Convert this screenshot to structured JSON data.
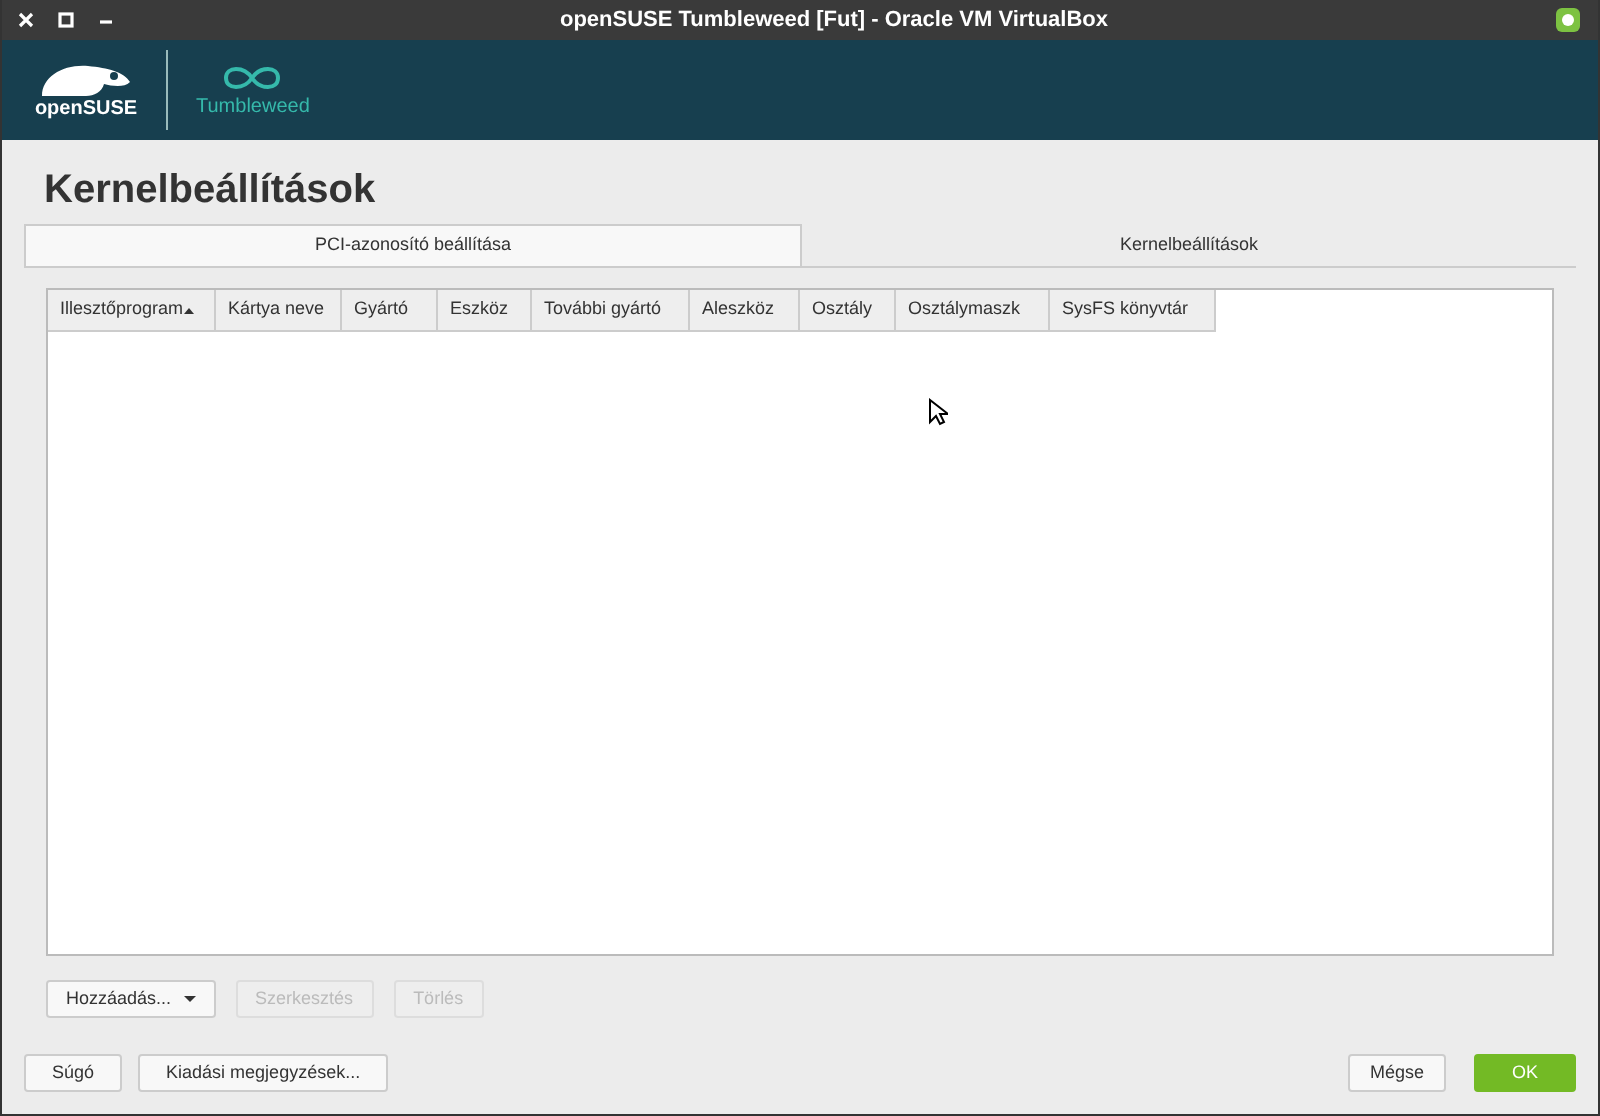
{
  "window": {
    "title": "openSUSE Tumbleweed [Fut] - Oracle VM VirtualBox"
  },
  "banner": {
    "brand": "openSUSE",
    "edition": "Tumbleweed"
  },
  "heading": "Kernelbeállítások",
  "tabs": [
    {
      "label": "PCI-azonosító beállítása",
      "selected": true
    },
    {
      "label": "Kernelbeállítások",
      "selected": false
    }
  ],
  "table": {
    "columns": [
      {
        "label": "Illesztőprogram",
        "sorted": true
      },
      {
        "label": "Kártya neve",
        "sorted": false
      },
      {
        "label": "Gyártó",
        "sorted": false
      },
      {
        "label": "Eszköz",
        "sorted": false
      },
      {
        "label": "További gyártó",
        "sorted": false
      },
      {
        "label": "Aleszköz",
        "sorted": false
      },
      {
        "label": "Osztály",
        "sorted": false
      },
      {
        "label": "Osztálymaszk",
        "sorted": false
      },
      {
        "label": "SysFS könyvtár",
        "sorted": false
      }
    ]
  },
  "table_buttons": [
    {
      "label": "Hozzáadás...",
      "disabled": false,
      "dropdown": true
    },
    {
      "label": "Szerkesztés",
      "disabled": true,
      "dropdown": false
    },
    {
      "label": "Törlés",
      "disabled": true,
      "dropdown": false
    }
  ],
  "footer_left": [
    {
      "label": "Súgó"
    },
    {
      "label": "Kiadási megjegyzések..."
    }
  ],
  "footer_right": [
    {
      "label": "Mégse",
      "kind": "plain"
    },
    {
      "label": "OK",
      "kind": "primary"
    }
  ]
}
